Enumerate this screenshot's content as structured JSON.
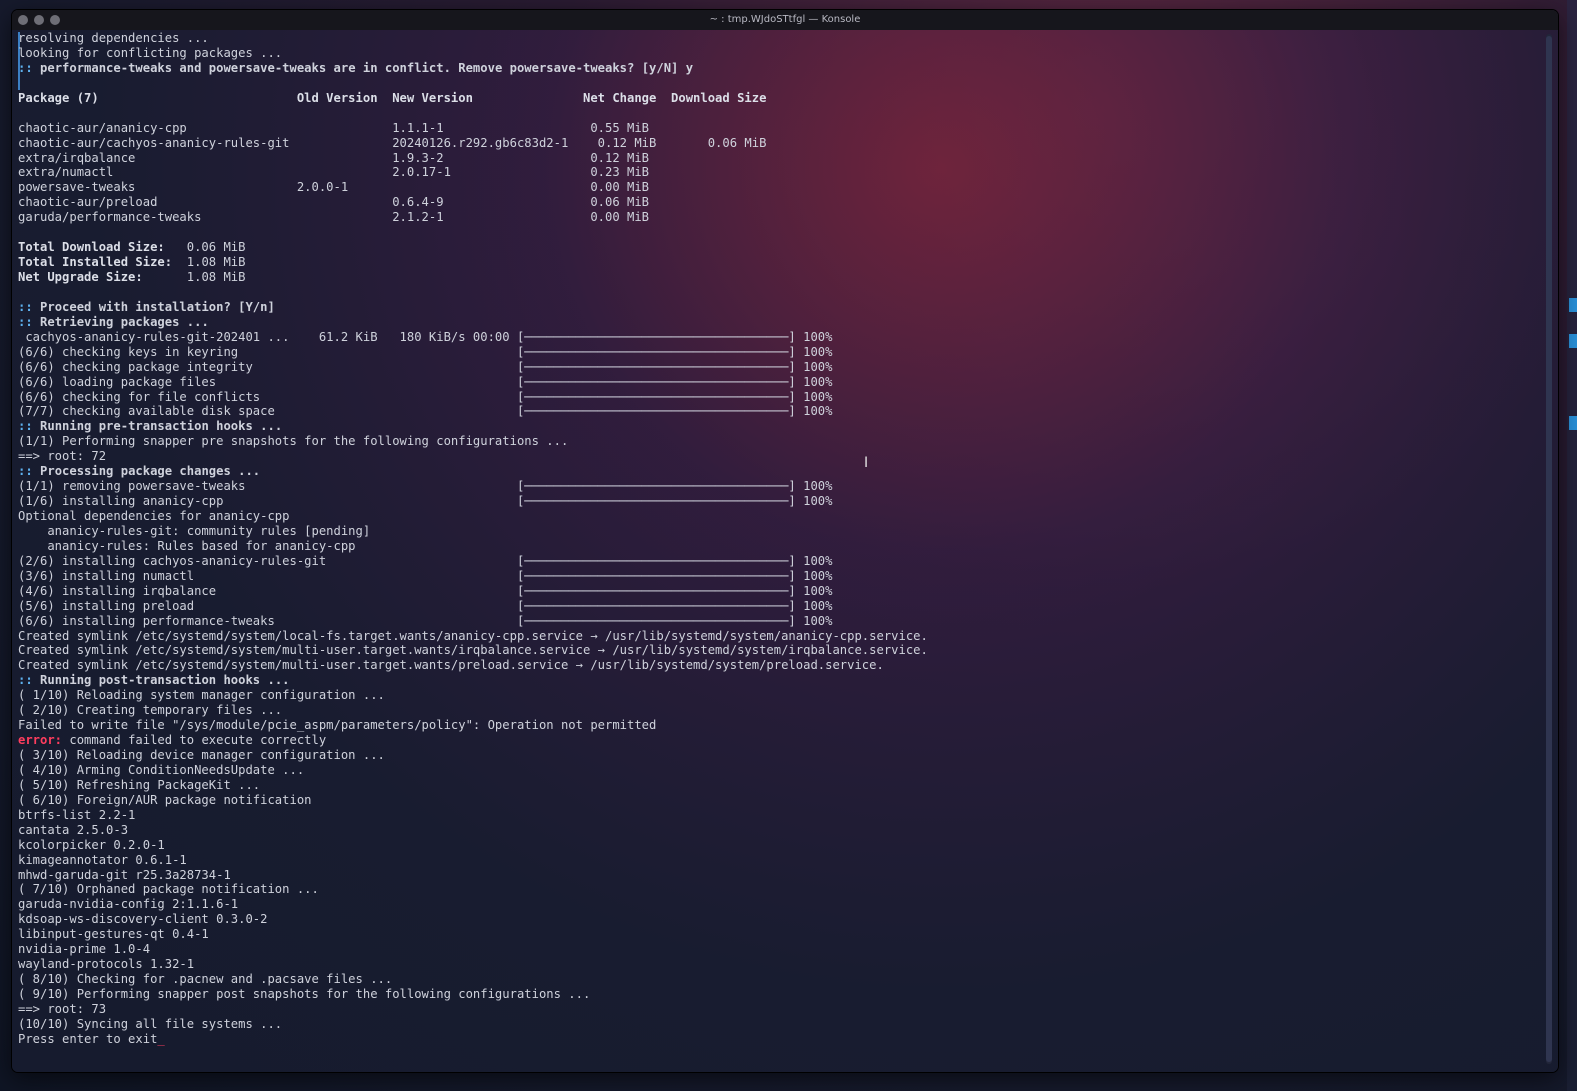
{
  "window": {
    "title": "~ : tmp.WJdoSTtfgl — Konsole"
  },
  "terminal": {
    "lines": [
      [
        "resolving dependencies ..."
      ],
      [
        "looking for conflicting packages ..."
      ],
      [
        [
          ":: ",
          "hook"
        ],
        [
          "performance-tweaks and powersave-tweaks are in conflict. Remove powersave-tweaks? [y/N] y",
          "hook-text"
        ]
      ],
      [
        ""
      ],
      [
        [
          "Package (7)                           Old Version  New Version               Net Change  Download Size",
          "header-row"
        ]
      ],
      [
        ""
      ],
      [
        "chaotic-aur/ananicy-cpp                            1.1.1-1                    0.55 MiB"
      ],
      [
        "chaotic-aur/cachyos-ananicy-rules-git              20240126.r292.gb6c83d2-1    0.12 MiB       0.06 MiB"
      ],
      [
        "extra/irqbalance                                   1.9.3-2                    0.12 MiB"
      ],
      [
        "extra/numactl                                      2.0.17-1                   0.23 MiB"
      ],
      [
        "powersave-tweaks                      2.0.0-1                                 0.00 MiB"
      ],
      [
        "chaotic-aur/preload                                0.6.4-9                    0.06 MiB"
      ],
      [
        "garuda/performance-tweaks                          2.1.2-1                    0.00 MiB"
      ],
      [
        ""
      ],
      [
        [
          "Total Download Size:",
          "header-row"
        ],
        "   0.06 MiB"
      ],
      [
        [
          "Total Installed Size:",
          "header-row"
        ],
        "  1.08 MiB"
      ],
      [
        [
          "Net Upgrade Size:",
          "header-row"
        ],
        "      1.08 MiB"
      ],
      [
        ""
      ],
      [
        [
          ":: ",
          "hook"
        ],
        [
          "Proceed with installation? [Y/n]",
          "hook-text"
        ]
      ],
      [
        [
          ":: ",
          "hook"
        ],
        [
          "Retrieving packages ...",
          "hook-text"
        ]
      ],
      [
        " cachyos-ananicy-rules-git-202401 ...    61.2 KiB   180 KiB/s 00:00 [────────────────────────────────────] 100%"
      ],
      [
        "(6/6) checking keys in keyring                                      [────────────────────────────────────] 100%"
      ],
      [
        "(6/6) checking package integrity                                    [────────────────────────────────────] 100%"
      ],
      [
        "(6/6) loading package files                                         [────────────────────────────────────] 100%"
      ],
      [
        "(6/6) checking for file conflicts                                   [────────────────────────────────────] 100%"
      ],
      [
        "(7/7) checking available disk space                                 [────────────────────────────────────] 100%"
      ],
      [
        [
          ":: ",
          "hook"
        ],
        [
          "Running pre-transaction hooks ...",
          "hook-text"
        ]
      ],
      [
        "(1/1) Performing snapper pre snapshots for the following configurations ..."
      ],
      [
        "==> root: 72"
      ],
      [
        [
          ":: ",
          "hook"
        ],
        [
          "Processing package changes ...",
          "hook-text"
        ]
      ],
      [
        "(1/1) removing powersave-tweaks                                     [────────────────────────────────────] 100%"
      ],
      [
        "(1/6) installing ananicy-cpp                                        [────────────────────────────────────] 100%"
      ],
      [
        "Optional dependencies for ananicy-cpp"
      ],
      [
        "    ananicy-rules-git: community rules [pending]"
      ],
      [
        "    ananicy-rules: Rules based for ananicy-cpp"
      ],
      [
        "(2/6) installing cachyos-ananicy-rules-git                          [────────────────────────────────────] 100%"
      ],
      [
        "(3/6) installing numactl                                            [────────────────────────────────────] 100%"
      ],
      [
        "(4/6) installing irqbalance                                         [────────────────────────────────────] 100%"
      ],
      [
        "(5/6) installing preload                                            [────────────────────────────────────] 100%"
      ],
      [
        "(6/6) installing performance-tweaks                                 [────────────────────────────────────] 100%"
      ],
      [
        "Created symlink /etc/systemd/system/local-fs.target.wants/ananicy-cpp.service → /usr/lib/systemd/system/ananicy-cpp.service."
      ],
      [
        "Created symlink /etc/systemd/system/multi-user.target.wants/irqbalance.service → /usr/lib/systemd/system/irqbalance.service."
      ],
      [
        "Created symlink /etc/systemd/system/multi-user.target.wants/preload.service → /usr/lib/systemd/system/preload.service."
      ],
      [
        [
          ":: ",
          "hook"
        ],
        [
          "Running post-transaction hooks ...",
          "hook-text"
        ]
      ],
      [
        "( 1/10) Reloading system manager configuration ..."
      ],
      [
        "( 2/10) Creating temporary files ..."
      ],
      [
        "Failed to write file \"/sys/module/pcie_aspm/parameters/policy\": Operation not permitted"
      ],
      [
        [
          "error:",
          "err-word"
        ],
        " command failed to execute correctly"
      ],
      [
        "( 3/10) Reloading device manager configuration ..."
      ],
      [
        "( 4/10) Arming ConditionNeedsUpdate ..."
      ],
      [
        "( 5/10) Refreshing PackageKit ..."
      ],
      [
        "( 6/10) Foreign/AUR package notification"
      ],
      [
        "btrfs-list 2.2-1"
      ],
      [
        "cantata 2.5.0-3"
      ],
      [
        "kcolorpicker 0.2.0-1"
      ],
      [
        "kimageannotator 0.6.1-1"
      ],
      [
        "mhwd-garuda-git r25.3a28734-1"
      ],
      [
        "( 7/10) Orphaned package notification ..."
      ],
      [
        "garuda-nvidia-config 2:1.1.6-1"
      ],
      [
        "kdsoap-ws-discovery-client 0.3.0-2"
      ],
      [
        "libinput-gestures-qt 0.4-1"
      ],
      [
        "nvidia-prime 1.0-4"
      ],
      [
        "wayland-protocols 1.32-1"
      ],
      [
        "( 8/10) Checking for .pacnew and .pacsave files ..."
      ],
      [
        "( 9/10) Performing snapper post snapshots for the following configurations ..."
      ],
      [
        "==> root: 73"
      ],
      [
        "(10/10) Syncing all file systems ..."
      ],
      [
        "Press enter to exit",
        [
          "_",
          "cursor"
        ]
      ]
    ]
  }
}
